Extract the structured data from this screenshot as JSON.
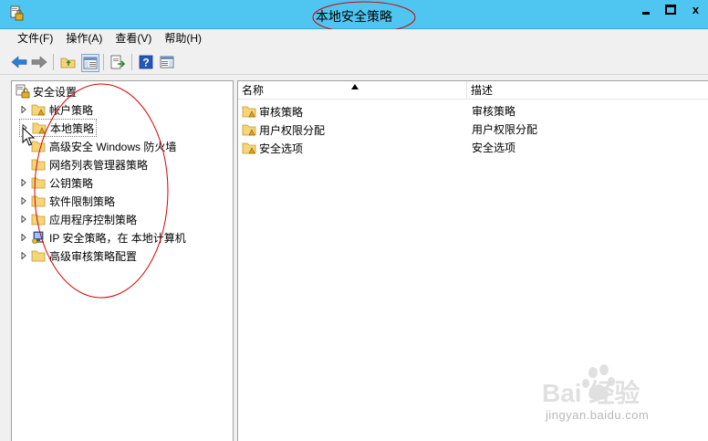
{
  "window": {
    "title": "本地安全策略",
    "close_glyph": "x"
  },
  "menu": [
    {
      "label": "文件(F)"
    },
    {
      "label": "操作(A)"
    },
    {
      "label": "查看(V)"
    },
    {
      "label": "帮助(H)"
    }
  ],
  "tree": {
    "root": "安全设置",
    "items": [
      {
        "label": "帐户策略",
        "expandable": true
      },
      {
        "label": "本地策略",
        "expandable": true
      },
      {
        "label": "高级安全 Windows 防火墙",
        "expandable": false
      },
      {
        "label": "网络列表管理器策略",
        "expandable": false
      },
      {
        "label": "公钥策略",
        "expandable": true
      },
      {
        "label": "软件限制策略",
        "expandable": true
      },
      {
        "label": "应用程序控制策略",
        "expandable": true
      },
      {
        "label": "IP 安全策略，在 本地计算机",
        "expandable": true
      },
      {
        "label": "高级审核策略配置",
        "expandable": true
      }
    ]
  },
  "list": {
    "columns": [
      "名称",
      "描述"
    ],
    "rows": [
      {
        "name": "审核策略",
        "desc": "审核策略"
      },
      {
        "name": "用户权限分配",
        "desc": "用户权限分配"
      },
      {
        "name": "安全选项",
        "desc": "安全选项"
      }
    ]
  },
  "watermark": {
    "logo": "Bai 经验",
    "url": "jingyan.baidu.com"
  },
  "colors": {
    "titlebar": "#4fc6f1",
    "annotation": "#d40000",
    "folder": "#f6d57a"
  }
}
